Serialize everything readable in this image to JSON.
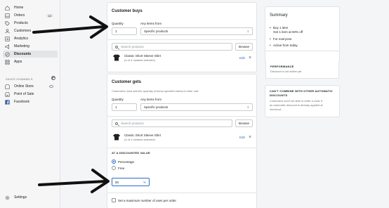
{
  "sidebar": {
    "items": [
      {
        "label": "Home",
        "icon": "home-icon"
      },
      {
        "label": "Orders",
        "icon": "orders-icon",
        "badge": "12"
      },
      {
        "label": "Products",
        "icon": "products-icon"
      },
      {
        "label": "Customers",
        "icon": "customers-icon"
      },
      {
        "label": "Analytics",
        "icon": "analytics-icon"
      },
      {
        "label": "Marketing",
        "icon": "marketing-icon"
      },
      {
        "label": "Discounts",
        "icon": "discounts-icon"
      },
      {
        "label": "Apps",
        "icon": "apps-icon"
      }
    ],
    "sales_channels_title": "SALES CHANNELS",
    "channels": [
      {
        "label": "Online Store",
        "icon": "store-icon"
      },
      {
        "label": "Point of Sale",
        "icon": "pos-icon"
      },
      {
        "label": "Facebook",
        "icon": "facebook-icon"
      }
    ],
    "settings_label": "Settings"
  },
  "buys": {
    "title": "Customer buys",
    "quantity_label": "Quantity",
    "quantity_value": "1",
    "any_items_label": "Any items from",
    "any_items_value": "Specific products",
    "search_placeholder": "Search products",
    "browse_label": "Browse",
    "product_name": "Classic Short Sleeve Shirt",
    "product_sub": "(4 of 4 variants selected)",
    "edit_label": "Edit"
  },
  "gets": {
    "title": "Customer gets",
    "description": "Customers must add the quantity of items specified below to their cart.",
    "quantity_label": "Quantity",
    "quantity_value": "1",
    "any_items_label": "Any items from",
    "any_items_value": "Specific products",
    "search_placeholder": "Search products",
    "browse_label": "Browse",
    "product_name": "Classic Short Sleeve Shirt",
    "product_sub": "(4 of 4 variants selected)",
    "edit_label": "Edit",
    "discounted_value_title": "AT A DISCOUNTED VALUE",
    "percentage_label": "Percentage",
    "free_label": "Free",
    "percent_value": "50",
    "percent_suffix": "%",
    "max_uses_label": "Set a maximum number of uses per order"
  },
  "summary": {
    "title": "Summary",
    "bullets": [
      "Buy 1 item",
      "Get 1 item at 50% off",
      "For everyone",
      "Active from today"
    ],
    "performance_title": "PERFORMANCE",
    "performance_text": "Discount is not active yet.",
    "combine_title_1": "CAN'T COMBINE WITH OTHER AUTOMATIC",
    "combine_title_2": "DISCOUNTS",
    "combine_text_1": "Customers won't be able to enter a code if",
    "combine_text_2": "an automatic discount is already applied at",
    "combine_text_3": "checkout."
  },
  "colors": {
    "accent": "#2c6ecb",
    "active_nav": "#e4e5e7",
    "arrow": "#111111"
  }
}
